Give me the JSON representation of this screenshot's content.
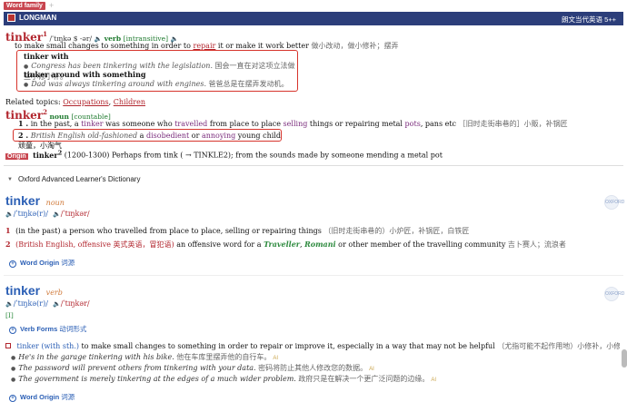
{
  "word_family": {
    "label": "Word family",
    "plus": "+"
  },
  "longman": {
    "name": "LONGMAN",
    "edition": "朗文当代英语 5++",
    "headword": "tinker",
    "homograph1": "1",
    "pron": "/ˈtɪŋkə $ -ər/",
    "pos": "verb",
    "gram": "[intransitive]",
    "def_a": "to make small changes to something in order to",
    "def_link": "repair",
    "def_b": "it or make it work better",
    "def_zh": "做小改动，做小修补；摆弄",
    "phrase1": "tinker with",
    "ex1": "Congress has been tinkering with the legislation.",
    "ex1_zh": "国会一直在对这项立法做些小修小补。",
    "phrase2": "tinker around with something",
    "ex2": "Dad was always tinkering around with engines.",
    "ex2_zh": "爸爸总是在摆弄发动机。",
    "related_label": "Related topics:",
    "related1": "Occupations",
    "related2": "Children",
    "homograph2": "2",
    "pos2": "noun",
    "gram2": "[countable]",
    "sense1_num": "1 .",
    "sense1_a": "in the past, a",
    "sense1_link1": "tinker",
    "sense1_b": "was someone who",
    "sense1_link2": "travelled",
    "sense1_c": "from place to place",
    "sense1_link3": "selling",
    "sense1_d": "things or repairing metal",
    "sense1_link4": "pots",
    "sense1_e": ", pans etc",
    "sense1_zh": "［旧时走街串巷的］小贩，补锅匠",
    "sense2_num": "2 .",
    "sense2_reg": "British English old-fashioned",
    "sense2_a": "a",
    "sense2_link1": "disobedient",
    "sense2_b": "or",
    "sense2_link2": "annoying",
    "sense2_c": "young child",
    "sense2_zh": "顽童，小淘气",
    "origin_label": "Origin",
    "origin_word": "tinker",
    "origin_sup": "2",
    "origin_text": "(1200-1300) Perhaps from tink ( → TINKLE2); from the sounds made by someone mending a metal pot"
  },
  "oxford": {
    "title": "Oxford Advanced Learner's Dictionary",
    "entry1": {
      "headword": "tinker",
      "pos": "noun",
      "pron_uk": "/ˈtɪŋkə(r)/",
      "pron_us": "/ˈtɪŋkər/",
      "badge": "OXFORD",
      "s1_num": "1",
      "s1_text": "(in the past) a person who travelled from place to place, selling or repairing things",
      "s1_zh": "（旧时走街串巷的）小炉匠，补锅匠，白铁匠",
      "s2_num": "2",
      "s2_reg": "(British English, offensive",
      "s2_reg_zh": "英式英语，冒犯语)",
      "s2_a": "an offensive word for a",
      "s2_k1": "Traveller",
      "s2_k2": "Romani",
      "s2_b": "or other member of the travelling community",
      "s2_zh": "吉卜赛人；流浪者",
      "word_origin": "Word Origin",
      "word_origin_zh": "词源"
    },
    "entry2": {
      "headword": "tinker",
      "pos": "verb",
      "pron_uk": "/ˈtɪŋkə(r)/",
      "pron_us": "/ˈtɪŋkər/",
      "badge": "OXFORD",
      "gram": "[I]",
      "verb_forms": "Verb Forms",
      "verb_forms_zh": "动词形式",
      "s1_head": "tinker (with sth.)",
      "s1_text": "to make small changes to something in order to repair or improve it, especially in a way that may not be helpful",
      "s1_zh": "（尤指可能不起作用地）小修补，小修理",
      "ex1": "He's in the garage tinkering with his bike.",
      "ex1_zh": "他在车库里摆弄他的自行车。",
      "ex2": "The password will prevent others from tinkering with your data.",
      "ex2_zh": "密码将防止其他人修改您的数据。",
      "ex3": "The government is merely tinkering at the edges of a much wider problem.",
      "ex3_zh": "政府只是在解决一个更广泛问题的边缘。",
      "ai": "AI",
      "word_origin": "Word Origin",
      "word_origin_zh": "词源"
    }
  },
  "icons": {
    "speaker": "speaker-icon",
    "plus": "plus-circle-icon"
  }
}
